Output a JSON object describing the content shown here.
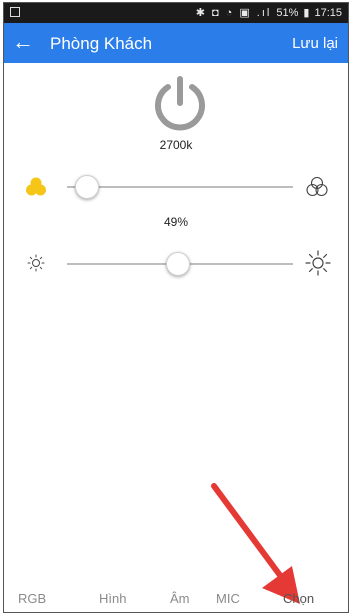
{
  "status_bar": {
    "icons": "✱ ◘ ◔ ▣ .ıl",
    "battery": "51%",
    "time": "17:15"
  },
  "app_bar": {
    "title": "Phòng Khách",
    "save_label": "Lưu lại",
    "back_icon": "arrow-left-icon"
  },
  "power_button": {
    "icon": "power-icon",
    "color": "#9a9a9a"
  },
  "color_temperature": {
    "label": "2700k",
    "level": 0.04,
    "left_icon": "warm-color-icon",
    "right_icon": "rgb-circles-icon"
  },
  "brightness": {
    "label": "49%",
    "level": 0.49,
    "left_icon": "dim-sun-icon",
    "right_icon": "bright-sun-icon"
  },
  "bottom_tabs": [
    {
      "label": "RGB"
    },
    {
      "label": "Hình"
    },
    {
      "label": "Âm"
    },
    {
      "label": "MIC"
    },
    {
      "label": "Chọn"
    }
  ],
  "colors": {
    "appbar": "#2b7de9",
    "arrow": "#e53935",
    "warm_icon": "#f5c518"
  }
}
